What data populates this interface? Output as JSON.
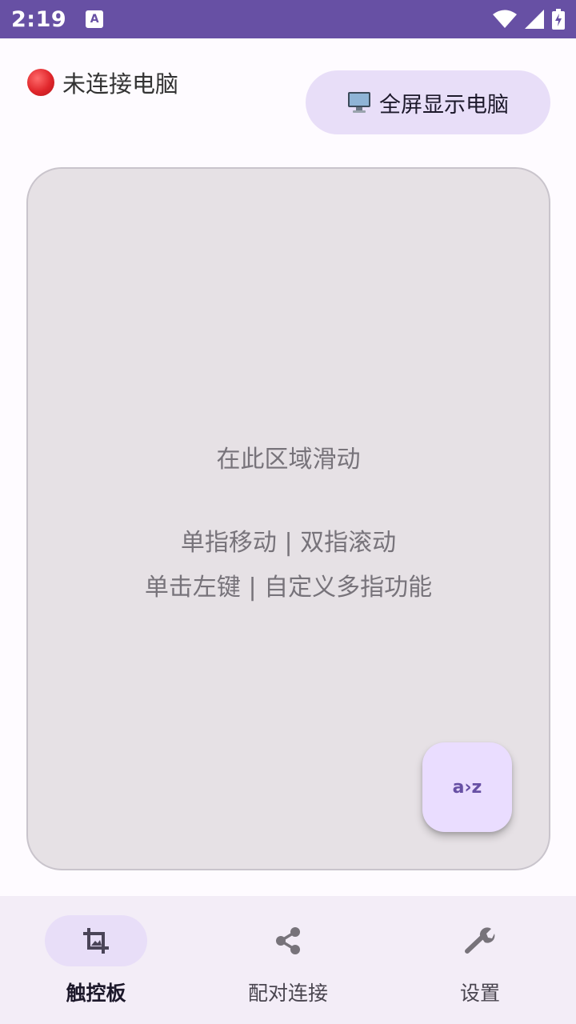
{
  "status_bar": {
    "time": "2:19",
    "notification_icon": "text-a-icon",
    "icons": [
      "wifi-icon",
      "signal-icon",
      "battery-icon"
    ]
  },
  "header": {
    "connection_status": "未连接电脑",
    "status_color": "#e0262b",
    "fullscreen_button": {
      "icon": "monitor-icon",
      "label": "全屏显示电脑"
    }
  },
  "touchpad": {
    "hint_title": "在此区域滑动",
    "hint_line1": "单指移动 | 双指滚动",
    "hint_line2": "单击左键 | 自定义多指功能",
    "fab_label": "a›z"
  },
  "bottom_nav": {
    "items": [
      {
        "label": "触控板",
        "icon": "crop-icon",
        "active": true
      },
      {
        "label": "配对连接",
        "icon": "share-icon",
        "active": false
      },
      {
        "label": "设置",
        "icon": "wrench-icon",
        "active": false
      }
    ]
  },
  "colors": {
    "accent": "#6750a4",
    "surface": "#e6e1e5",
    "pill": "#e8def8"
  }
}
